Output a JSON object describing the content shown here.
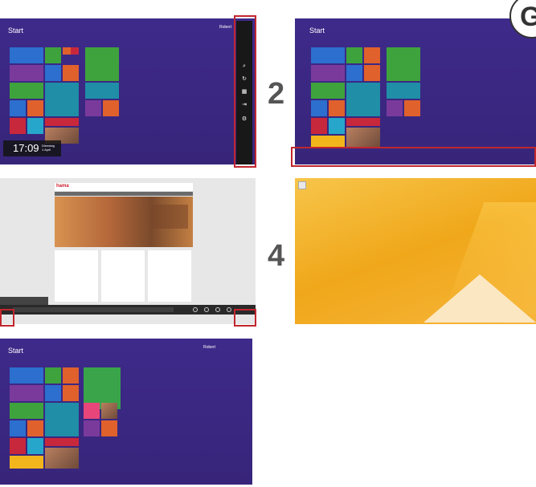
{
  "panel1": {
    "start_label": "Start",
    "user_name": "Robert",
    "clock_time": "17:09",
    "clock_day": "Dienstag",
    "clock_date": "1 April"
  },
  "panel2": {
    "step_number": "2",
    "start_label": "Start"
  },
  "panel3": {
    "site_logo": "hama"
  },
  "panel4": {
    "step_number": "4"
  },
  "panel5": {
    "start_label": "Start",
    "user_name": "Robert"
  },
  "corner_badge": {
    "letter": "G"
  },
  "colors": {
    "start_bg": "#3e2a8a",
    "highlight_red": "#c2262e",
    "desktop_yellow": "#f0a71a"
  }
}
